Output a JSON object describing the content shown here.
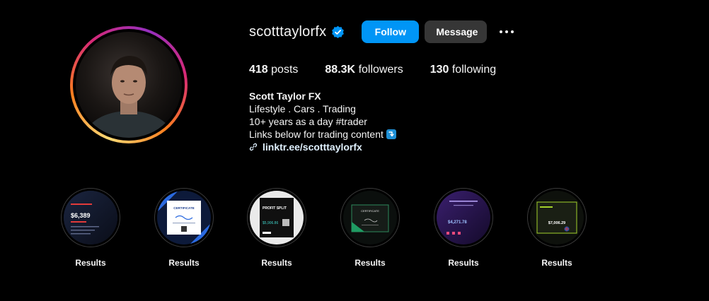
{
  "profile": {
    "username": "scotttaylorfx",
    "verified_icon": "verified-badge-icon",
    "follow_label": "Follow",
    "message_label": "Message",
    "more_icon": "more-options-icon"
  },
  "stats": {
    "posts_count": "418",
    "posts_label": "posts",
    "followers_count": "88.3K",
    "followers_label": "followers",
    "following_count": "130",
    "following_label": "following"
  },
  "bio": {
    "name": "Scott Taylor FX",
    "line1": "Lifestyle . Cars . Trading",
    "line2": "10+ years as a day #trader",
    "line3": "Links below for trading content",
    "line3_emoji": "down-arrow-emoji-icon",
    "link": "linktr.ee/scotttaylorfx",
    "link_icon": "link-icon"
  },
  "highlights": [
    {
      "label": "Results",
      "thumb_text": "$6,389"
    },
    {
      "label": "Results",
      "thumb_text": "CERTIFICATE"
    },
    {
      "label": "Results",
      "thumb_text": "PROFIT SPLIT"
    },
    {
      "label": "Results",
      "thumb_text": "CERTIFICATE"
    },
    {
      "label": "Results",
      "thumb_text": "$4,271.78"
    },
    {
      "label": "Results",
      "thumb_text": "$7,006.29"
    }
  ],
  "colors": {
    "background": "#000000",
    "primary_button": "#0095f6",
    "secondary_button": "#363636",
    "verified": "#0095f6"
  }
}
